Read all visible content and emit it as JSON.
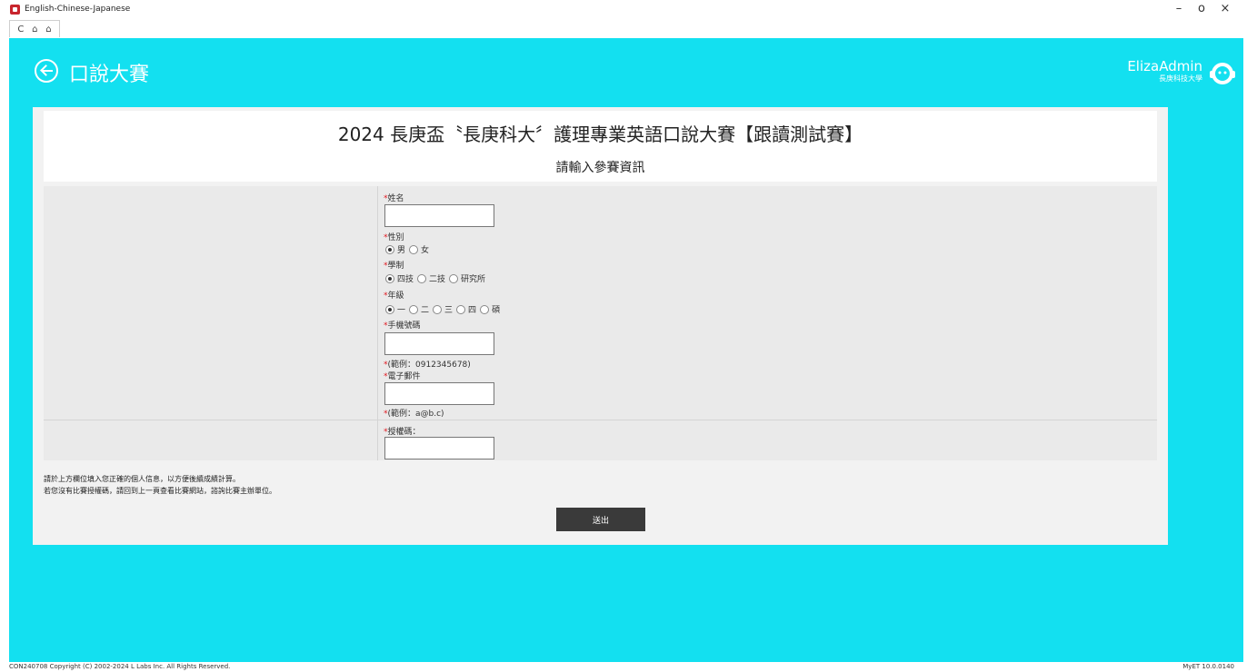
{
  "window": {
    "title": "English-Chinese-Japanese",
    "controls": {
      "minimize": "–",
      "maximize": "o",
      "close": "×"
    }
  },
  "nav": {
    "back": "C",
    "home": "⌂",
    "up": "⌂"
  },
  "header": {
    "title": "口說大賽",
    "brand_name": "ElizaAdmin",
    "brand_sub": "長庚科技大學"
  },
  "panel": {
    "title": "2024 長庚盃〝長庚科大〞護理專業英語口說大賽【跟讀測試賽】",
    "subtitle": "請輸入參賽資訊"
  },
  "form": {
    "required_mark": "*",
    "name_label": "姓名",
    "gender_label": "性別",
    "gender_options": [
      "男",
      "女"
    ],
    "gender_selected": "男",
    "school_label": "學制",
    "school_options": [
      "四技",
      "二技",
      "研究所"
    ],
    "school_selected": "四技",
    "grade_label": "年級",
    "grade_options": [
      "一",
      "二",
      "三",
      "四",
      "碩"
    ],
    "grade_selected": "一",
    "phone_label": "手機號碼",
    "phone_hint": "(範例：0912345678)",
    "email_label": "電子郵件",
    "email_hint": "(範例：a@b.c)",
    "auth_label": "授權碼："
  },
  "notes": {
    "line1": "請於上方欄位填入您正確的個人信息，以方便後續成績計算。",
    "line2": "若您沒有比賽授權碼，請回到上一頁查看比賽網站，諮詢比賽主辦單位。"
  },
  "submit_label": "送出",
  "footer": {
    "copyright": "CON240708 Copyright (C) 2002-2024 L Labs Inc. All Rights Reserved.",
    "version": "MyET 10.0.0140"
  },
  "colors": {
    "background": "#13e0f0",
    "button": "#3a3a3a",
    "required": "#e0161e"
  }
}
